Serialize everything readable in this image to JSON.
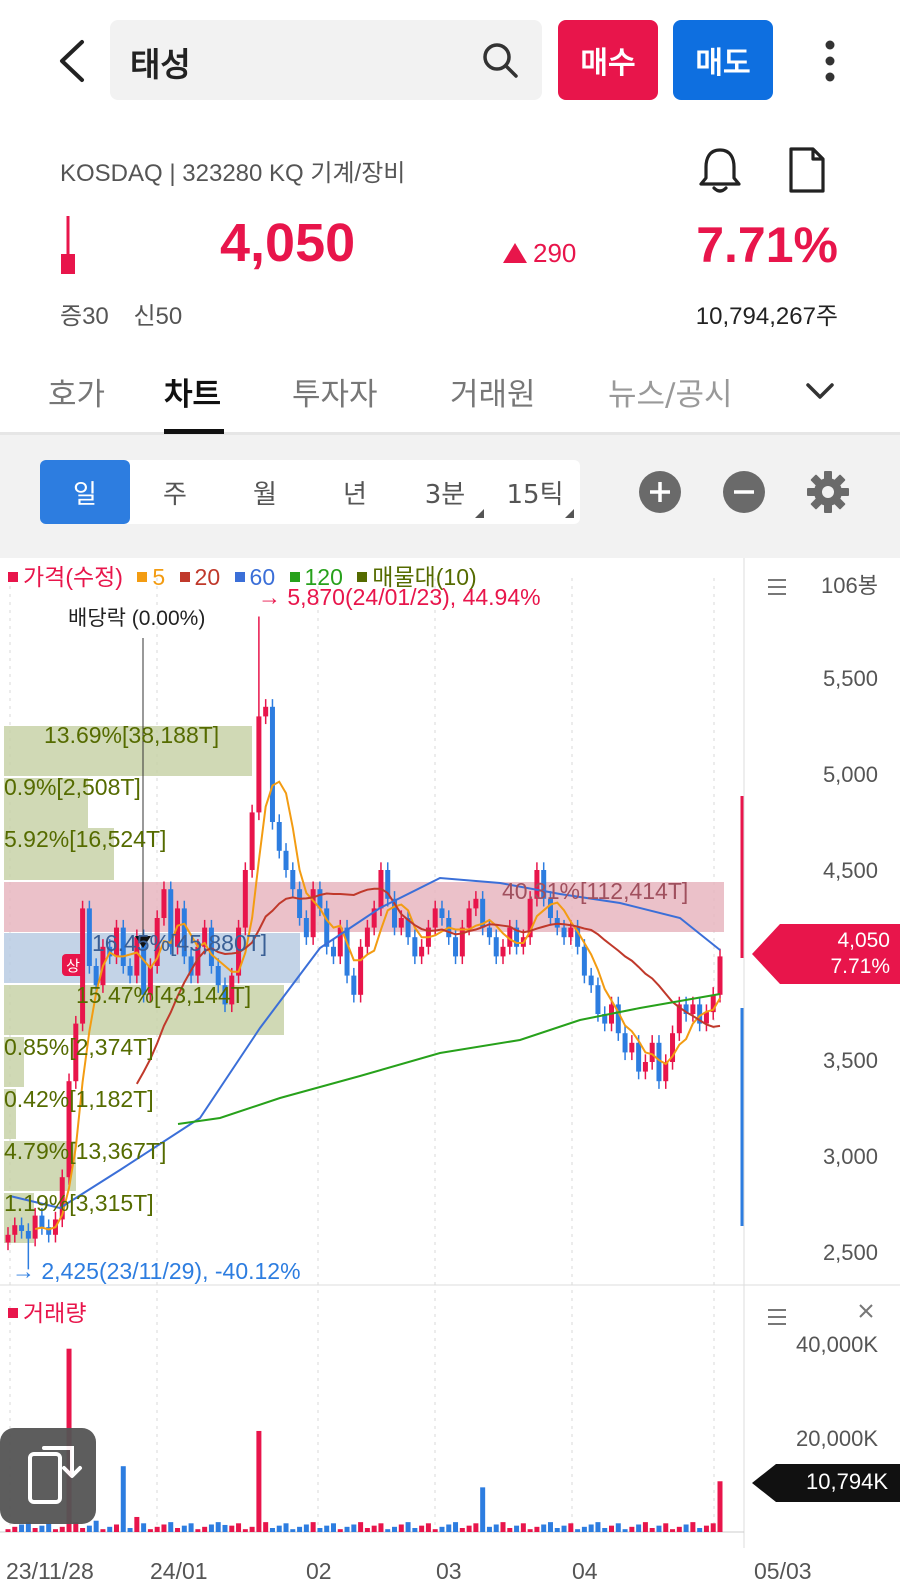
{
  "header": {
    "stock_name": "태성",
    "buy_label": "매수",
    "sell_label": "매도"
  },
  "info": {
    "market": "KOSDAQ",
    "code": "323280 KQ",
    "sector": "기계/장비",
    "price": "4,050",
    "change": "290",
    "change_pct": "7.71%",
    "margin_rate": "증30",
    "credit_rate": "신50",
    "volume": "10,794,267주"
  },
  "tabs": [
    "호가",
    "차트",
    "투자자",
    "거래원",
    "뉴스/공시"
  ],
  "period_buttons": [
    "일",
    "주",
    "월",
    "년",
    "3분",
    "15틱"
  ],
  "chart": {
    "legend": {
      "price": "가격(수정)",
      "ma5": "5",
      "ma20": "20",
      "ma60": "60",
      "ma120": "120",
      "vp": "매물대(10)"
    },
    "candle_count": "106봉",
    "high_note": "→ 5,870(24/01/23), 44.94%",
    "low_note": "→ 2,425(23/11/29), -40.12%",
    "dividend_note": "배당락 (0.00%)",
    "limit_up_badge": "상",
    "price_tag": "4,050",
    "price_tag_pct": "7.71%",
    "volume_legend": "거래량",
    "volume_tag": "10,794K",
    "y_labels": [
      "5,500",
      "5,000",
      "4,500",
      "3,500",
      "3,000",
      "2,500"
    ],
    "vol_y_labels": [
      "40,000K",
      "20,000K"
    ],
    "x_labels": [
      "23/11/28",
      "24/01",
      "02",
      "03",
      "04",
      "05/03"
    ],
    "volume_profile": [
      {
        "label": "13.69%[38,188T]"
      },
      {
        "label": "0.9%[2,508T]"
      },
      {
        "label": "5.92%[16,524T]"
      },
      {
        "label": "40.31%[112,414T]"
      },
      {
        "label": "16.45%[45,880T]"
      },
      {
        "label": "15.47%[43,144T]"
      },
      {
        "label": "0.85%[2,374T]"
      },
      {
        "label": "0.42%[1,182T]"
      },
      {
        "label": "4.79%[13,367T]"
      },
      {
        "label": "1.19%[3,315T]"
      }
    ]
  },
  "colors": {
    "up": "#e8154b",
    "down": "#2d7de0",
    "ma5": "#f39c12",
    "ma20": "#c0392b",
    "ma60": "#3b6fd8",
    "ma120": "#27a11b",
    "vp": "#556b00"
  },
  "icons": [
    "back-icon",
    "search-icon",
    "more-vertical-icon",
    "bell-icon",
    "document-icon",
    "chevron-down-icon",
    "zoom-in-icon",
    "zoom-out-icon",
    "gear-icon",
    "menu-icon",
    "close-icon",
    "screen-rotate-icon"
  ]
}
